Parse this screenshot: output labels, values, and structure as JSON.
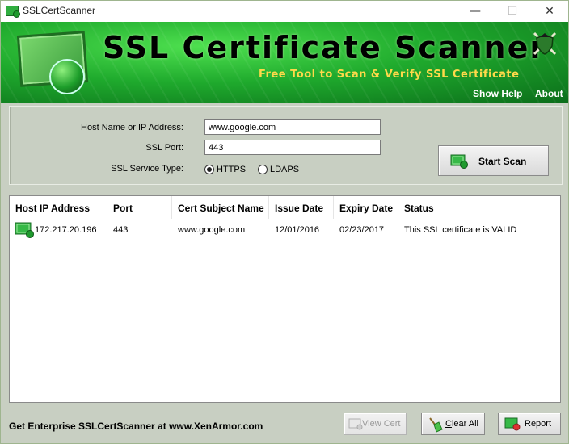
{
  "window": {
    "title": "SSLCertScanner",
    "controls": {
      "minimize": "—",
      "maximize": "☐",
      "close": "✕"
    }
  },
  "banner": {
    "title": "SSL Certificate Scanner",
    "subtitle": "Free Tool to Scan & Verify SSL Certificate",
    "links": {
      "help": "Show Help",
      "about": "About"
    }
  },
  "form": {
    "host_label": "Host Name or IP Address:",
    "host_value": "www.google.com",
    "port_label": "SSL Port:",
    "port_value": "443",
    "service_label": "SSL Service Type:",
    "service_options": [
      {
        "label": "HTTPS",
        "selected": true
      },
      {
        "label": "LDAPS",
        "selected": false
      }
    ],
    "scan_button": "Start Scan"
  },
  "results": {
    "columns": [
      "Host IP Address",
      "Port",
      "Cert Subject Name",
      "Issue Date",
      "Expiry Date",
      "Status"
    ],
    "rows": [
      {
        "host": "172.217.20.196",
        "port": "443",
        "subject": "www.google.com",
        "issue": "12/01/2016",
        "expiry": "02/23/2017",
        "status": "This SSL certificate is VALID"
      }
    ]
  },
  "footer": {
    "promo": "Get Enterprise SSLCertScanner at www.XenArmor.com",
    "view_cert": {
      "label": "View Cert",
      "enabled": false
    },
    "clear_all": {
      "prefix": "",
      "accel": "C",
      "rest": "lear All"
    },
    "report": "Report"
  },
  "colors": {
    "brand_green": "#1faa2d",
    "subtitle_gold": "#ffd94a"
  }
}
